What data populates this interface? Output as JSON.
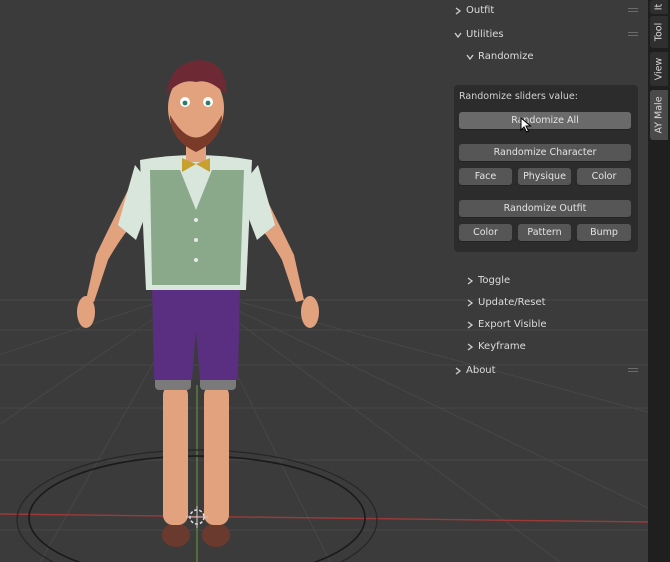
{
  "panel": {
    "outfit": "Outfit",
    "utilities": "Utilities",
    "randomize": "Randomize",
    "randomize_sliders_label": "Randomize sliders value:",
    "randomize_all": "Randomize All",
    "randomize_character": "Randomize Character",
    "character_buttons": [
      "Face",
      "Physique",
      "Color"
    ],
    "randomize_outfit": "Randomize Outfit",
    "outfit_buttons": [
      "Color",
      "Pattern",
      "Bump"
    ],
    "toggle": "Toggle",
    "update_reset": "Update/Reset",
    "export_visible": "Export Visible",
    "keyframe": "Keyframe",
    "about": "About"
  },
  "tabs": [
    "It",
    "Tool",
    "View",
    "AY Male"
  ],
  "colors": {
    "panel_bg": "#3d3d3d",
    "box_bg": "#2c2c2c",
    "button": "#565656",
    "vest": "#8aa88a",
    "shorts": "#5a2f82",
    "hair": "#6e2a34",
    "bowtie": "#c8a030"
  }
}
